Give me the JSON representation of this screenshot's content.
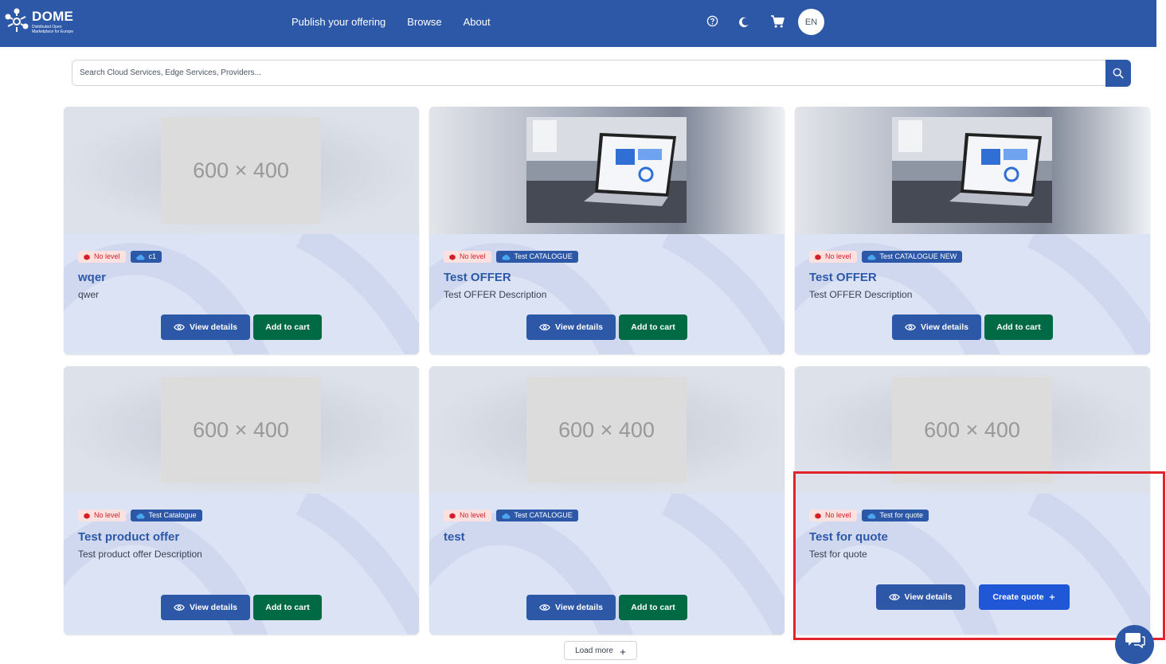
{
  "header": {
    "logo_title": "DOME",
    "logo_subtitle_1": "Distributed Open",
    "logo_subtitle_2": "Marketplace for Europe",
    "nav": [
      "Publish your offering",
      "Browse",
      "About"
    ],
    "language": "EN",
    "color": "#2d58a7"
  },
  "search": {
    "placeholder": "Search Cloud Services, Edge Services, Providers..."
  },
  "cards": [
    {
      "image": "placeholder",
      "image_text": "600 × 400",
      "level": "No level",
      "catalogue": "c1",
      "title": "wqer",
      "description": "qwer",
      "view_label": "View details",
      "action_label": "Add to cart"
    },
    {
      "image": "laptop-photo",
      "image_text": "",
      "level": "No level",
      "catalogue": "Test CATALOGUE",
      "title": "Test OFFER",
      "description": "Test OFFER Description",
      "view_label": "View details",
      "action_label": "Add to cart"
    },
    {
      "image": "laptop-photo",
      "image_text": "",
      "level": "No level",
      "catalogue": "Test CATALOGUE NEW",
      "title": "Test OFFER",
      "description": "Test OFFER Description",
      "view_label": "View details",
      "action_label": "Add to cart"
    },
    {
      "image": "placeholder",
      "image_text": "600 × 400",
      "level": "No level",
      "catalogue": "Test Catalogue",
      "title": "Test product offer",
      "description": "Test product offer Description",
      "view_label": "View details",
      "action_label": "Add to cart"
    },
    {
      "image": "placeholder",
      "image_text": "600 × 400",
      "level": "No level",
      "catalogue": "Test CATALOGUE",
      "title": "test",
      "description": "",
      "view_label": "View details",
      "action_label": "Add to cart"
    },
    {
      "image": "placeholder",
      "image_text": "600 × 400",
      "level": "No level",
      "catalogue": "Test for quote",
      "title": "Test for quote",
      "description": "Test for quote",
      "view_label": "View details",
      "action_label": "Create quote"
    }
  ],
  "load_more": "Load more",
  "colors": {
    "primary": "#2d58a7",
    "cart": "#006a45",
    "quote": "#1f57d6",
    "badge_red": "#d11f27",
    "highlight": "#e3232c"
  }
}
